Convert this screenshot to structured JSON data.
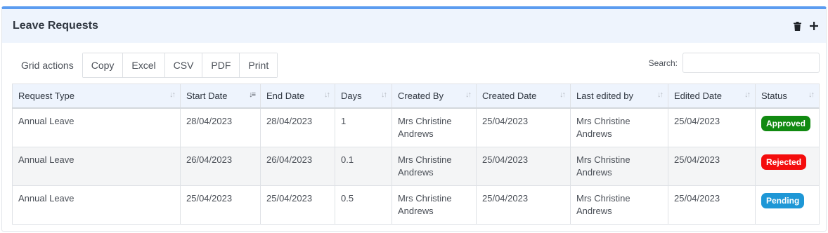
{
  "panel": {
    "title": "Leave Requests"
  },
  "header_icons": [
    "trash-icon",
    "plus-icon"
  ],
  "toolbar": {
    "grid_actions_label": "Grid actions",
    "buttons": [
      "Copy",
      "Excel",
      "CSV",
      "PDF",
      "Print"
    ],
    "search_label": "Search:",
    "search_value": ""
  },
  "table": {
    "columns": [
      "Request Type",
      "Start Date",
      "End Date",
      "Days",
      "Created By",
      "Created Date",
      "Last edited by",
      "Edited Date",
      "Status"
    ],
    "sorted_column": "Start Date",
    "rows": [
      {
        "request_type": "Annual Leave",
        "start_date": "28/04/2023",
        "end_date": "28/04/2023",
        "days": "1",
        "created_by": "Mrs Christine Andrews",
        "created_date": "25/04/2023",
        "last_edited_by": "Mrs Christine Andrews",
        "edited_date": "25/04/2023",
        "status": "Approved"
      },
      {
        "request_type": "Annual Leave",
        "start_date": "26/04/2023",
        "end_date": "26/04/2023",
        "days": "0.1",
        "created_by": "Mrs Christine Andrews",
        "created_date": "25/04/2023",
        "last_edited_by": "Mrs Christine Andrews",
        "edited_date": "25/04/2023",
        "status": "Rejected"
      },
      {
        "request_type": "Annual Leave",
        "start_date": "25/04/2023",
        "end_date": "25/04/2023",
        "days": "0.5",
        "created_by": "Mrs Christine Andrews",
        "created_date": "25/04/2023",
        "last_edited_by": "Mrs Christine Andrews",
        "edited_date": "25/04/2023",
        "status": "Pending"
      }
    ]
  },
  "colors": {
    "accent": "#5b9cf0",
    "approved": "#118a11",
    "rejected": "#f40d0d",
    "pending": "#1e97d6"
  }
}
